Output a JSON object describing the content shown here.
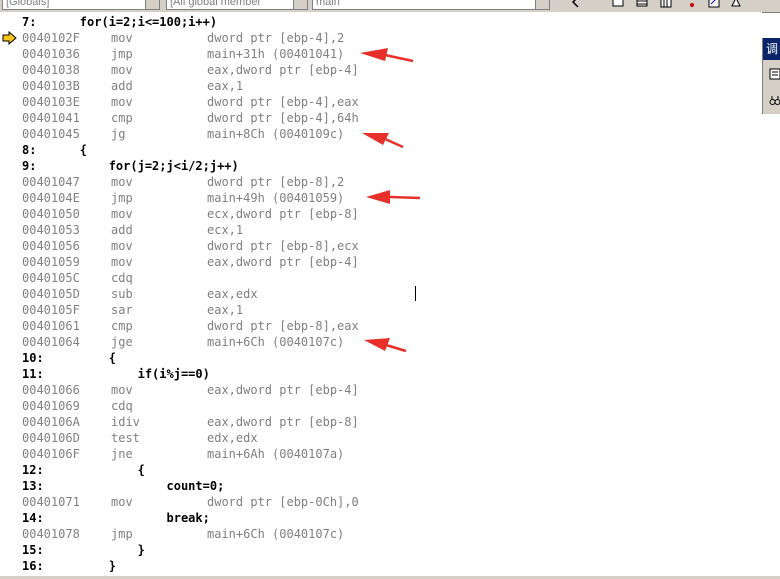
{
  "toolbar": {
    "class_combo": "[Globals]",
    "member_combo": "[All global member",
    "function_combo": "main"
  },
  "side_panel": {
    "title": "调"
  },
  "disassembly": [
    {
      "kind": "src",
      "text": "7:      for(i=2;i<=100;i++)"
    },
    {
      "kind": "asm",
      "addr": "0040102F",
      "mnem": "mov",
      "ops": "dword ptr [ebp-4],2",
      "current": true
    },
    {
      "kind": "asm",
      "addr": "00401036",
      "mnem": "jmp",
      "ops": "main+31h (00401041)"
    },
    {
      "kind": "asm",
      "addr": "00401038",
      "mnem": "mov",
      "ops": "eax,dword ptr [ebp-4]"
    },
    {
      "kind": "asm",
      "addr": "0040103B",
      "mnem": "add",
      "ops": "eax,1"
    },
    {
      "kind": "asm",
      "addr": "0040103E",
      "mnem": "mov",
      "ops": "dword ptr [ebp-4],eax"
    },
    {
      "kind": "asm",
      "addr": "00401041",
      "mnem": "cmp",
      "ops": "dword ptr [ebp-4],64h"
    },
    {
      "kind": "asm",
      "addr": "00401045",
      "mnem": "jg",
      "ops": "main+8Ch (0040109c)"
    },
    {
      "kind": "src",
      "text": "8:      {"
    },
    {
      "kind": "src",
      "text": "9:          for(j=2;j<i/2;j++)"
    },
    {
      "kind": "asm",
      "addr": "00401047",
      "mnem": "mov",
      "ops": "dword ptr [ebp-8],2"
    },
    {
      "kind": "asm",
      "addr": "0040104E",
      "mnem": "jmp",
      "ops": "main+49h (00401059)"
    },
    {
      "kind": "asm",
      "addr": "00401050",
      "mnem": "mov",
      "ops": "ecx,dword ptr [ebp-8]"
    },
    {
      "kind": "asm",
      "addr": "00401053",
      "mnem": "add",
      "ops": "ecx,1"
    },
    {
      "kind": "asm",
      "addr": "00401056",
      "mnem": "mov",
      "ops": "dword ptr [ebp-8],ecx"
    },
    {
      "kind": "asm",
      "addr": "00401059",
      "mnem": "mov",
      "ops": "eax,dword ptr [ebp-4]"
    },
    {
      "kind": "asm",
      "addr": "0040105C",
      "mnem": "cdq",
      "ops": ""
    },
    {
      "kind": "asm",
      "addr": "0040105D",
      "mnem": "sub",
      "ops": "eax,edx"
    },
    {
      "kind": "asm",
      "addr": "0040105F",
      "mnem": "sar",
      "ops": "eax,1"
    },
    {
      "kind": "asm",
      "addr": "00401061",
      "mnem": "cmp",
      "ops": "dword ptr [ebp-8],eax"
    },
    {
      "kind": "asm",
      "addr": "00401064",
      "mnem": "jge",
      "ops": "main+6Ch (0040107c)"
    },
    {
      "kind": "src",
      "text": "10:         {"
    },
    {
      "kind": "src",
      "text": "11:             if(i%j==0)"
    },
    {
      "kind": "asm",
      "addr": "00401066",
      "mnem": "mov",
      "ops": "eax,dword ptr [ebp-4]"
    },
    {
      "kind": "asm",
      "addr": "00401069",
      "mnem": "cdq",
      "ops": ""
    },
    {
      "kind": "asm",
      "addr": "0040106A",
      "mnem": "idiv",
      "ops": "eax,dword ptr [ebp-8]"
    },
    {
      "kind": "asm",
      "addr": "0040106D",
      "mnem": "test",
      "ops": "edx,edx"
    },
    {
      "kind": "asm",
      "addr": "0040106F",
      "mnem": "jne",
      "ops": "main+6Ah (0040107a)"
    },
    {
      "kind": "src",
      "text": "12:             {"
    },
    {
      "kind": "src",
      "text": "13:                 count=0;"
    },
    {
      "kind": "asm",
      "addr": "00401071",
      "mnem": "mov",
      "ops": "dword ptr [ebp-0Ch],0"
    },
    {
      "kind": "src",
      "text": "14:                 break;"
    },
    {
      "kind": "asm",
      "addr": "00401078",
      "mnem": "jmp",
      "ops": "main+6Ch (0040107c)"
    },
    {
      "kind": "src",
      "text": "15:             }"
    },
    {
      "kind": "src",
      "text": "16:         }"
    }
  ],
  "colors": {
    "source_text": "#000000",
    "asm_text": "#808080",
    "annotation_arrow": "#e8302a",
    "current_line_marker": "#f5c518"
  }
}
